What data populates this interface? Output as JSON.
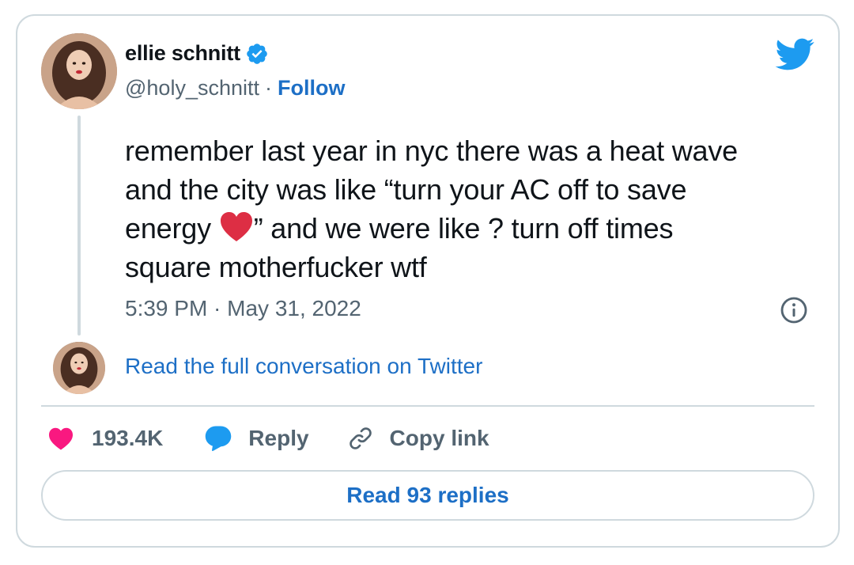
{
  "author": {
    "name": "ellie schnitt",
    "handle": "@holy_schnitt",
    "separator": "·",
    "follow_label": "Follow",
    "avatar_icon": "profile-photo"
  },
  "tweet": {
    "line1": "remember last year in nyc there was a heat wave",
    "line2": "and the city was like “turn your AC off to save",
    "line3_before": "energy ",
    "line3_after": "” and we were like ? turn off times",
    "line4": "square motherfucker wtf",
    "emoji": "red-heart",
    "timestamp": "5:39 PM · May 31, 2022"
  },
  "conversation_link": "Read the full conversation on Twitter",
  "actions": {
    "likes": "193.4K",
    "reply_label": "Reply",
    "copy_label": "Copy link"
  },
  "read_replies_label": "Read 93 replies",
  "colors": {
    "accent": "#1d6fc6",
    "twitter_blue": "#1d9bf0",
    "like_pink": "#f91880",
    "muted": "#536471",
    "border": "#cfd9de"
  }
}
